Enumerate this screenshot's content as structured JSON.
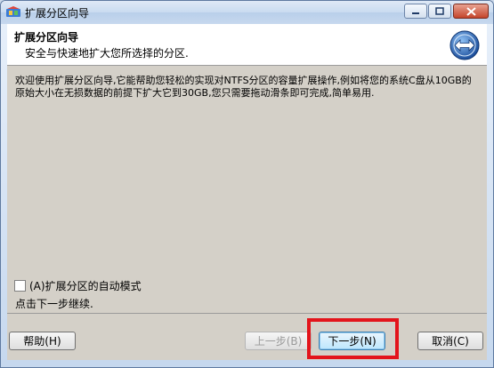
{
  "window": {
    "title": "扩展分区向导"
  },
  "header": {
    "title": "扩展分区向导",
    "subtitle": "安全与快速地扩大您所选择的分区."
  },
  "body": {
    "description": "欢迎使用扩展分区向导,它能帮助您轻松的实现对NTFS分区的容量扩展操作,例如将您的系统C盘从10GB的原始大小在无损数据的前提下扩大它到30GB,您只需要拖动滑条即可完成,简单易用.",
    "auto_mode_label": "(A)扩展分区的自动模式",
    "auto_mode_checked": false,
    "hint": "点击下一步继续."
  },
  "buttons": {
    "help": "帮助(H)",
    "back": "上一步(B)",
    "next": "下一步(N)",
    "cancel": "取消(C)"
  },
  "colors": {
    "highlight": "#e3141b",
    "accent": "#2a62b5"
  }
}
